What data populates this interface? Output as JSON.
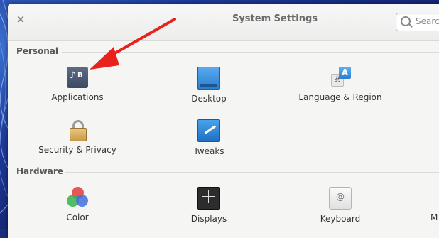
{
  "window": {
    "title": "System Settings",
    "search_placeholder": "Searc"
  },
  "sections": {
    "personal": "Personal",
    "hardware": "Hardware"
  },
  "personal_items": [
    {
      "label": "Applications",
      "icon": "applications-icon"
    },
    {
      "label": "Desktop",
      "icon": "desktop-icon"
    },
    {
      "label": "Language & Region",
      "icon": "language-icon"
    },
    {
      "label": "Security & Privacy",
      "icon": "lock-icon"
    },
    {
      "label": "Tweaks",
      "icon": "tweaks-icon"
    }
  ],
  "hardware_items": [
    {
      "label": "Color",
      "icon": "color-icon"
    },
    {
      "label": "Displays",
      "icon": "displays-icon"
    },
    {
      "label": "Keyboard",
      "icon": "keyboard-icon"
    },
    {
      "label": "M",
      "icon": "partial-item"
    }
  ],
  "annotation": {
    "color": "#e8221c"
  }
}
